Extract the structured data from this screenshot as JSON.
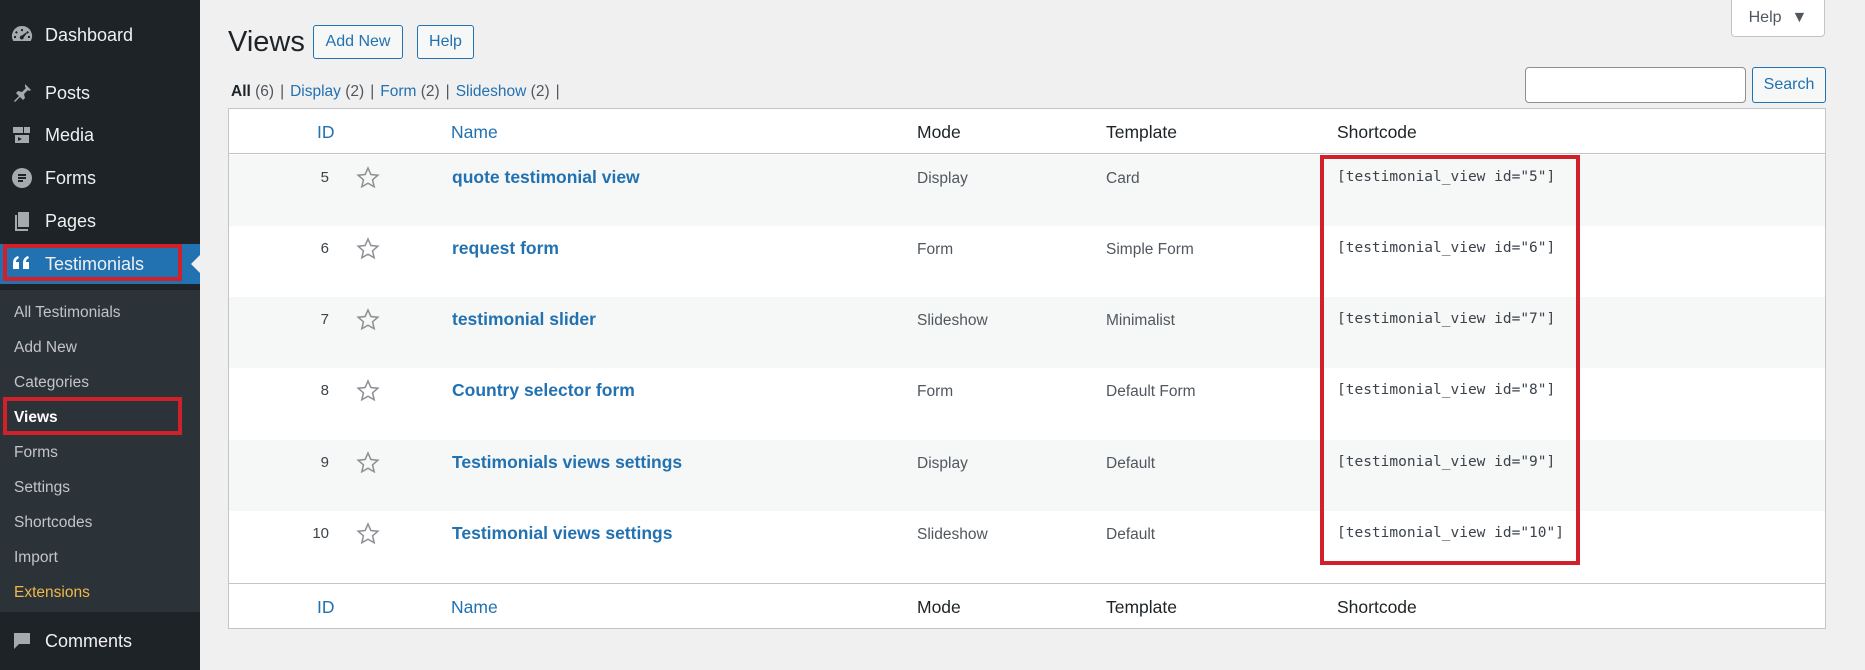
{
  "sidebar": {
    "dashboard": "Dashboard",
    "posts": "Posts",
    "media": "Media",
    "forms": "Forms",
    "pages": "Pages",
    "testimonials": "Testimonials",
    "comments": "Comments",
    "submenu": [
      "All Testimonials",
      "Add New",
      "Categories",
      "Views",
      "Forms",
      "Settings",
      "Shortcodes",
      "Import",
      "Extensions"
    ]
  },
  "header": {
    "title": "Views",
    "add_new": "Add New",
    "help": "Help",
    "help_tab": "Help"
  },
  "filters": {
    "all": {
      "label": "All",
      "count": "(6)"
    },
    "display": {
      "label": "Display",
      "count": "(2)"
    },
    "form": {
      "label": "Form",
      "count": "(2)"
    },
    "slideshow": {
      "label": "Slideshow",
      "count": "(2)"
    }
  },
  "search": {
    "value": "",
    "button": "Search"
  },
  "table": {
    "columns": {
      "id": "ID",
      "name": "Name",
      "mode": "Mode",
      "template": "Template",
      "shortcode": "Shortcode"
    },
    "rows": [
      {
        "id": "5",
        "name": "quote testimonial view",
        "mode": "Display",
        "template": "Card",
        "shortcode": "[testimonial_view id=\"5\"]"
      },
      {
        "id": "6",
        "name": "request form",
        "mode": "Form",
        "template": "Simple Form",
        "shortcode": "[testimonial_view id=\"6\"]"
      },
      {
        "id": "7",
        "name": "testimonial slider",
        "mode": "Slideshow",
        "template": "Minimalist",
        "shortcode": "[testimonial_view id=\"7\"]"
      },
      {
        "id": "8",
        "name": "Country selector form",
        "mode": "Form",
        "template": "Default Form",
        "shortcode": "[testimonial_view id=\"8\"]"
      },
      {
        "id": "9",
        "name": "Testimonials views settings",
        "mode": "Display",
        "template": "Default",
        "shortcode": "[testimonial_view id=\"9\"]"
      },
      {
        "id": "10",
        "name": "Testimonial views settings",
        "mode": "Slideshow",
        "template": "Default",
        "shortcode": "[testimonial_view id=\"10\"]"
      }
    ]
  },
  "colors": {
    "sidebar_bg": "#1d2327",
    "accent": "#2271b1",
    "highlight": "#d0202a"
  }
}
